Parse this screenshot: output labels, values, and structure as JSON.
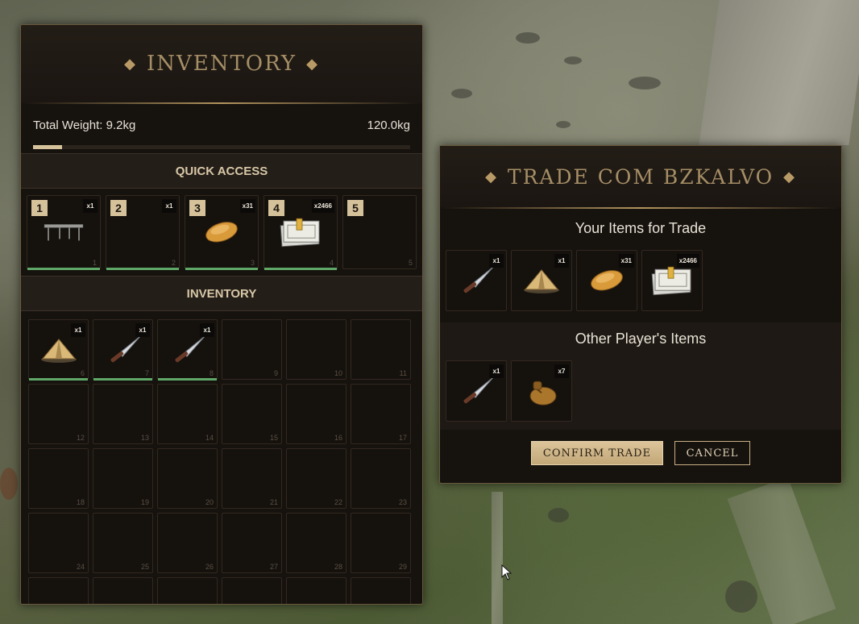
{
  "inventory": {
    "title": "INVENTORY",
    "total_weight_label": "Total Weight: 9.2kg",
    "max_weight_label": "120.0kg",
    "weight_fraction": 0.077,
    "quick_access_label": "QUICK ACCESS",
    "inventory_label": "INVENTORY",
    "quick_slots": [
      {
        "badge": "1",
        "qty": "x1",
        "index": "1",
        "icon": "table-icon",
        "durability": true
      },
      {
        "badge": "2",
        "qty": "x1",
        "index": "2",
        "icon": "",
        "durability": true
      },
      {
        "badge": "3",
        "qty": "x31",
        "index": "3",
        "icon": "bread-icon",
        "durability": true
      },
      {
        "badge": "4",
        "qty": "x2466",
        "index": "4",
        "icon": "money-stack-icon",
        "durability": true
      },
      {
        "badge": "5",
        "qty": "",
        "index": "5",
        "icon": "",
        "durability": false
      }
    ],
    "slots": [
      {
        "qty": "x1",
        "index": "6",
        "icon": "tent-icon",
        "durability": true
      },
      {
        "qty": "x1",
        "index": "7",
        "icon": "knife-icon",
        "durability": true
      },
      {
        "qty": "x1",
        "index": "8",
        "icon": "knife-icon",
        "durability": true
      },
      {
        "qty": "",
        "index": "9",
        "icon": "",
        "durability": false
      },
      {
        "qty": "",
        "index": "10",
        "icon": "",
        "durability": false
      },
      {
        "qty": "",
        "index": "11",
        "icon": "",
        "durability": false
      },
      {
        "qty": "",
        "index": "12",
        "icon": "",
        "durability": false
      },
      {
        "qty": "",
        "index": "13",
        "icon": "",
        "durability": false
      },
      {
        "qty": "",
        "index": "14",
        "icon": "",
        "durability": false
      },
      {
        "qty": "",
        "index": "15",
        "icon": "",
        "durability": false
      },
      {
        "qty": "",
        "index": "16",
        "icon": "",
        "durability": false
      },
      {
        "qty": "",
        "index": "17",
        "icon": "",
        "durability": false
      },
      {
        "qty": "",
        "index": "18",
        "icon": "",
        "durability": false
      },
      {
        "qty": "",
        "index": "19",
        "icon": "",
        "durability": false
      },
      {
        "qty": "",
        "index": "20",
        "icon": "",
        "durability": false
      },
      {
        "qty": "",
        "index": "21",
        "icon": "",
        "durability": false
      },
      {
        "qty": "",
        "index": "22",
        "icon": "",
        "durability": false
      },
      {
        "qty": "",
        "index": "23",
        "icon": "",
        "durability": false
      },
      {
        "qty": "",
        "index": "24",
        "icon": "",
        "durability": false
      },
      {
        "qty": "",
        "index": "25",
        "icon": "",
        "durability": false
      },
      {
        "qty": "",
        "index": "26",
        "icon": "",
        "durability": false
      },
      {
        "qty": "",
        "index": "27",
        "icon": "",
        "durability": false
      },
      {
        "qty": "",
        "index": "28",
        "icon": "",
        "durability": false
      },
      {
        "qty": "",
        "index": "29",
        "icon": "",
        "durability": false
      },
      {
        "qty": "",
        "index": "",
        "icon": "",
        "durability": false
      },
      {
        "qty": "",
        "index": "",
        "icon": "",
        "durability": false
      },
      {
        "qty": "",
        "index": "",
        "icon": "",
        "durability": false
      },
      {
        "qty": "",
        "index": "",
        "icon": "",
        "durability": false
      },
      {
        "qty": "",
        "index": "",
        "icon": "",
        "durability": false
      },
      {
        "qty": "",
        "index": "",
        "icon": "",
        "durability": false
      }
    ]
  },
  "trade": {
    "title": "TRADE COM BZKALVO",
    "your_items_label": "Your Items for Trade",
    "other_items_label": "Other Player's Items",
    "your_items": [
      {
        "qty": "x1",
        "icon": "knife-icon"
      },
      {
        "qty": "x1",
        "icon": "tent-icon"
      },
      {
        "qty": "x31",
        "icon": "bread-icon"
      },
      {
        "qty": "x2466",
        "icon": "money-stack-icon"
      }
    ],
    "other_items": [
      {
        "qty": "x1",
        "icon": "knife-icon"
      },
      {
        "qty": "x7",
        "icon": "pouch-icon"
      }
    ],
    "confirm_label": "CONFIRM TRADE",
    "cancel_label": "CANCEL"
  },
  "colors": {
    "accent_gold": "#d6c29a",
    "durability_green": "#5fa868",
    "panel_bg": "#16120e"
  }
}
